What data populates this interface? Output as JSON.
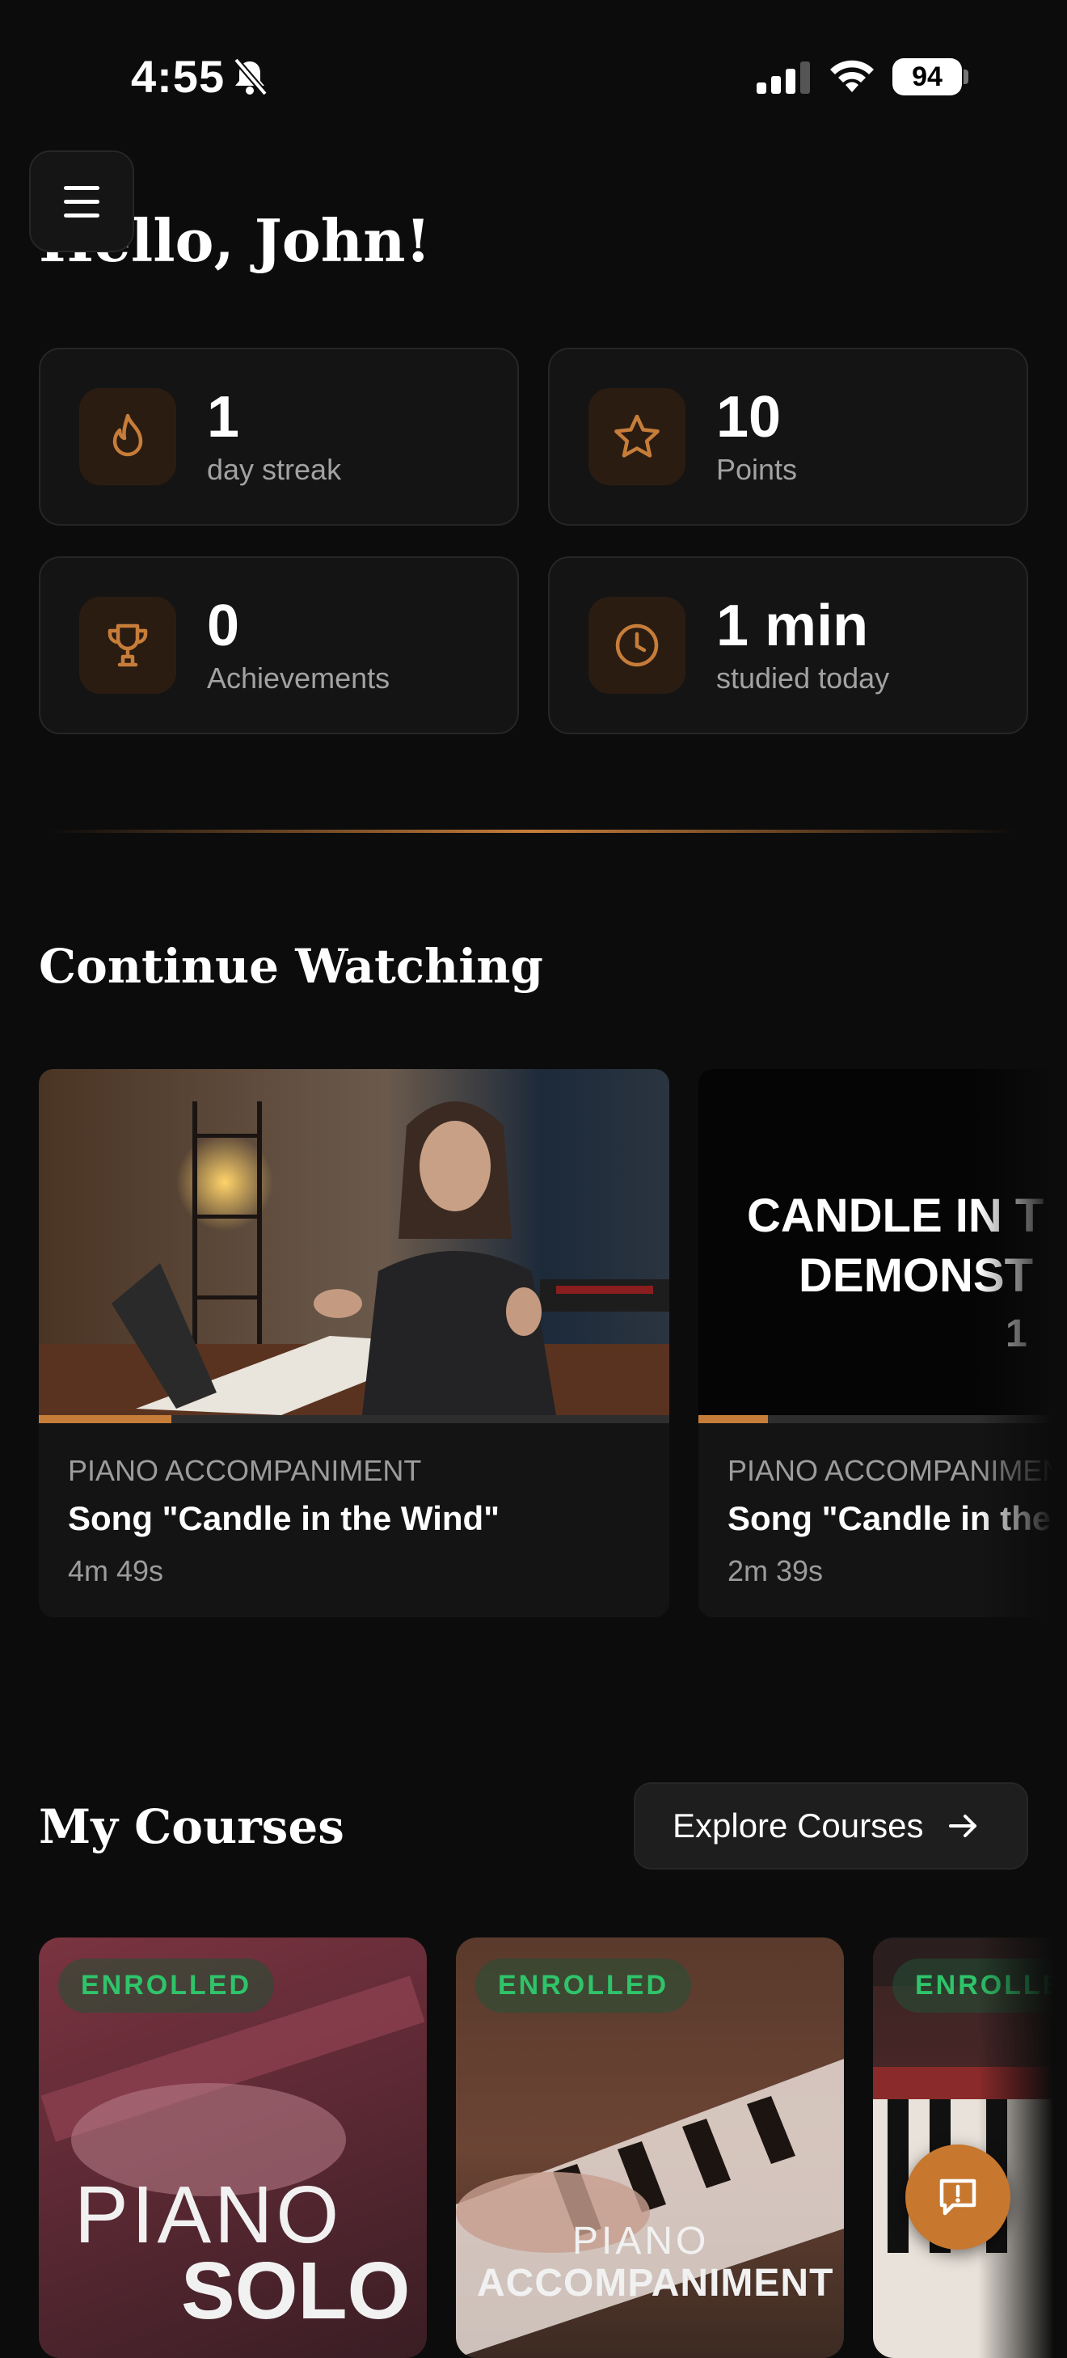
{
  "status_bar": {
    "time": "4:55",
    "battery": "94"
  },
  "greeting": "Hello, John!",
  "stats": [
    {
      "value": "1",
      "label": "day streak",
      "icon": "flame-icon"
    },
    {
      "value": "10",
      "label": "Points",
      "icon": "star-icon"
    },
    {
      "value": "0",
      "label": "Achievements",
      "icon": "trophy-icon"
    },
    {
      "value": "1 min",
      "label": "studied today",
      "icon": "clock-icon"
    }
  ],
  "continue_watching": {
    "title": "Continue Watching",
    "items": [
      {
        "category": "PIANO ACCOMPANIMENT",
        "title": "Song \"Candle in the Wind\"",
        "duration": "4m 49s",
        "progress": 0.21
      },
      {
        "category": "PIANO ACCOMPANIMENT",
        "title": "Song \"Candle in the Wind\"",
        "duration": "2m 39s",
        "progress": 0.11,
        "thumb_text": [
          "CANDLE IN T",
          "DEMONST",
          "1"
        ]
      }
    ]
  },
  "my_courses": {
    "title": "My Courses",
    "explore_label": "Explore Courses",
    "items": [
      {
        "badge": "ENROLLED",
        "title_line1": "PIANO",
        "title_line2": "SOLO"
      },
      {
        "badge": "ENROLLED",
        "title_line1": "PIANO",
        "title_line2": "ACCOMPANIMENT"
      },
      {
        "badge": "ENROLLED"
      }
    ]
  },
  "colors": {
    "accent": "#c77d3a",
    "enrolled": "#2fc46a",
    "background": "#0c0c0c",
    "card": "#141414"
  }
}
